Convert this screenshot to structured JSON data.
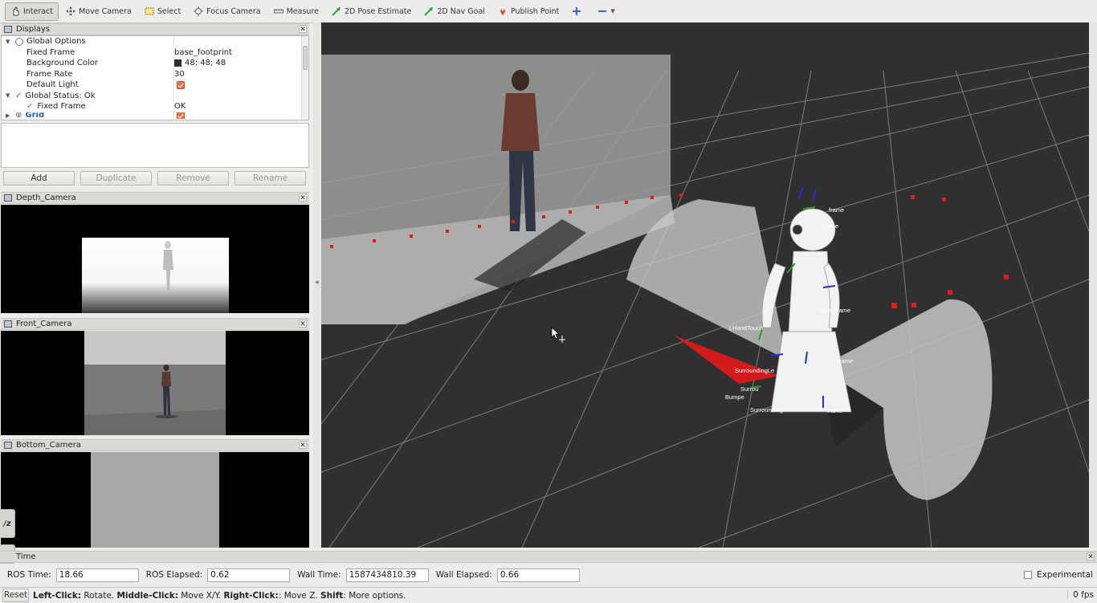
{
  "toolbar": {
    "tools": [
      {
        "label": "Interact",
        "icon": "hand-cursor-icon"
      },
      {
        "label": "Move Camera",
        "icon": "move-camera-icon"
      },
      {
        "label": "Select",
        "icon": "select-icon"
      },
      {
        "label": "Focus Camera",
        "icon": "focus-camera-icon"
      },
      {
        "label": "Measure",
        "icon": "ruler-icon"
      },
      {
        "label": "2D Pose Estimate",
        "icon": "green-arrow-icon"
      },
      {
        "label": "2D Nav Goal",
        "icon": "green-arrow-icon"
      },
      {
        "label": "Publish Point",
        "icon": "map-pin-icon"
      }
    ]
  },
  "displays": {
    "title": "Displays",
    "rows": [
      {
        "label": "Global Options",
        "value": ""
      },
      {
        "label": "Fixed Frame",
        "value": "base_footprint"
      },
      {
        "label": "Background Color",
        "value": "48; 48; 48"
      },
      {
        "label": "Frame Rate",
        "value": "30"
      },
      {
        "label": "Default Light",
        "value": ""
      },
      {
        "label": "Global Status: Ok",
        "value": ""
      },
      {
        "label": "Fixed Frame",
        "value": "OK"
      },
      {
        "label": "Grid",
        "value": ""
      }
    ],
    "buttons": {
      "add": "Add",
      "duplicate": "Duplicate",
      "remove": "Remove",
      "rename": "Rename"
    }
  },
  "cameras": {
    "depth": "Depth_Camera",
    "front": "Front_Camera",
    "bottom": "Bottom_Camera"
  },
  "time": {
    "title": "Time",
    "ros_time_label": "ROS Time:",
    "ros_time": "18.66",
    "ros_elapsed_label": "ROS Elapsed:",
    "ros_elapsed": "0.62",
    "wall_time_label": "Wall Time:",
    "wall_time": "1587434810.39",
    "wall_elapsed_label": "Wall Elapsed:",
    "wall_elapsed": "0.66",
    "experimental": "Experimental"
  },
  "status": {
    "reset": "Reset",
    "k1": "Left-Click:",
    "t1": " Rotate. ",
    "k2": "Middle-Click:",
    "t2": " Move X/Y. ",
    "k3": "Right-Click:",
    "t3": ": Move Z. ",
    "k4": "Shift",
    "t4": ": More options.",
    "fps": "0 fps"
  },
  "frame_labels": [
    "frame",
    "LHandTouch",
    "back_frame",
    "SurroundingLe",
    "Surrou",
    "Bumpe",
    "Surrounding",
    "frame",
    "frame",
    "frame"
  ],
  "colors": {
    "background": "#303030",
    "accent": "#e8754f"
  }
}
